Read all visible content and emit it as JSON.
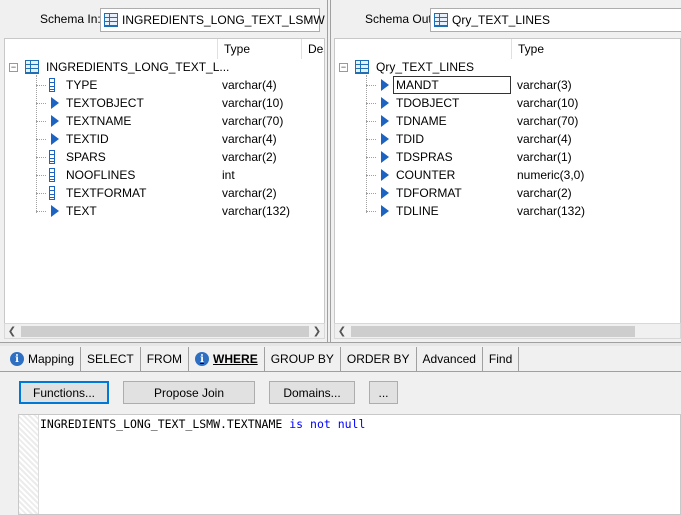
{
  "left": {
    "schema_label": "Schema In:",
    "schema_value": "INGREDIENTS_LONG_TEXT_LSMW",
    "columns": [
      "Type",
      "Des"
    ],
    "root": "INGREDIENTS_LONG_TEXT_L...",
    "rows": [
      {
        "name": "TYPE",
        "type": "varchar(4)",
        "icon": "key-icon"
      },
      {
        "name": "TEXTOBJECT",
        "type": "varchar(10)",
        "icon": "arrow-icon"
      },
      {
        "name": "TEXTNAME",
        "type": "varchar(70)",
        "icon": "arrow-icon"
      },
      {
        "name": "TEXTID",
        "type": "varchar(4)",
        "icon": "arrow-icon"
      },
      {
        "name": "SPARS",
        "type": "varchar(2)",
        "icon": "key-icon"
      },
      {
        "name": "NOOFLINES",
        "type": "int",
        "icon": "key-icon"
      },
      {
        "name": "TEXTFORMAT",
        "type": "varchar(2)",
        "icon": "key-icon"
      },
      {
        "name": "TEXT",
        "type": "varchar(132)",
        "icon": "arrow-icon"
      }
    ]
  },
  "right": {
    "schema_label": "Schema Out:",
    "schema_value": "Qry_TEXT_LINES",
    "columns": [
      "Type"
    ],
    "root": "Qry_TEXT_LINES",
    "rows": [
      {
        "name": "MANDT",
        "type": "varchar(3)",
        "icon": "arrow-icon",
        "selected": true
      },
      {
        "name": "TDOBJECT",
        "type": "varchar(10)",
        "icon": "arrow-icon"
      },
      {
        "name": "TDNAME",
        "type": "varchar(70)",
        "icon": "arrow-icon"
      },
      {
        "name": "TDID",
        "type": "varchar(4)",
        "icon": "arrow-icon"
      },
      {
        "name": "TDSPRAS",
        "type": "varchar(1)",
        "icon": "arrow-icon"
      },
      {
        "name": "COUNTER",
        "type": "numeric(3,0)",
        "icon": "arrow-icon"
      },
      {
        "name": "TDFORMAT",
        "type": "varchar(2)",
        "icon": "arrow-icon"
      },
      {
        "name": "TDLINE",
        "type": "varchar(132)",
        "icon": "arrow-icon"
      }
    ]
  },
  "tabs": [
    {
      "label": "Mapping",
      "icon": "info-icon"
    },
    {
      "label": "SELECT"
    },
    {
      "label": "FROM"
    },
    {
      "label": "WHERE",
      "icon": "info-icon",
      "active": true
    },
    {
      "label": "GROUP BY"
    },
    {
      "label": "ORDER BY"
    },
    {
      "label": "Advanced"
    },
    {
      "label": "Find"
    }
  ],
  "buttons": {
    "functions": "Functions...",
    "propose_join": "Propose Join",
    "domains": "Domains...",
    "more": "..."
  },
  "editor": {
    "code_prefix": "INGREDIENTS_LONG_TEXT_LSMW.TEXTNAME ",
    "code_keywords": "is not null"
  },
  "colors": {
    "accent": "#1c63c2",
    "keyword": "#0000ff"
  }
}
